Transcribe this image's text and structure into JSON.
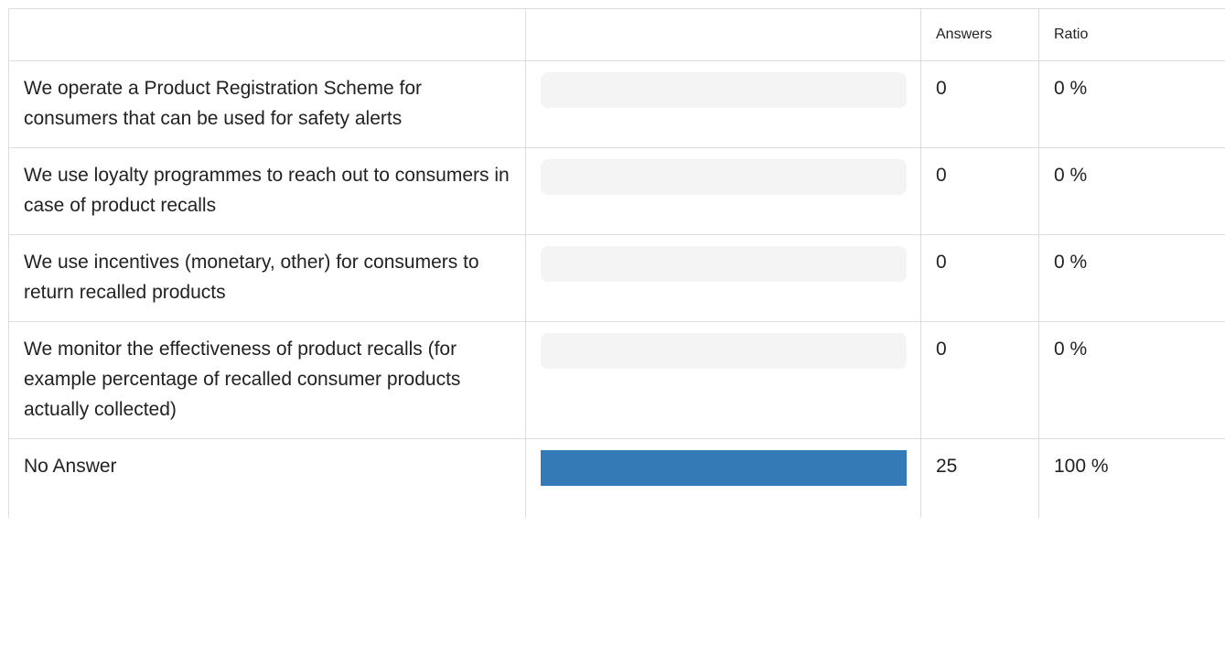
{
  "table": {
    "headers": {
      "label": "",
      "bar": "",
      "answers": "Answers",
      "ratio": "Ratio"
    },
    "rows": [
      {
        "label": "We operate a Product Registration Scheme for consumers that can be used for safety alerts",
        "answers": "0",
        "ratio": "0 %",
        "fraction": 0
      },
      {
        "label": "We use loyalty programmes to reach out to consumers in case of product recalls",
        "answers": "0",
        "ratio": "0 %",
        "fraction": 0
      },
      {
        "label": "We use incentives (monetary, other) for consumers to return recalled products",
        "answers": "0",
        "ratio": "0 %",
        "fraction": 0
      },
      {
        "label": "We monitor the effectiveness of product recalls (for example percentage of recalled consumer products actually collected)",
        "answers": "0",
        "ratio": "0 %",
        "fraction": 0
      },
      {
        "label": "No Answer",
        "answers": "25",
        "ratio": "100 %",
        "fraction": 1
      }
    ]
  },
  "colors": {
    "bar_fill": "#337ab7",
    "bar_track": "#f4f4f4",
    "border": "#dddddd"
  }
}
